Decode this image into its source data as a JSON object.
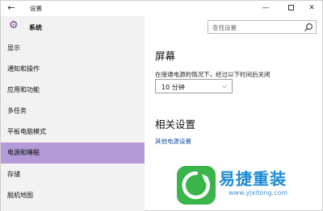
{
  "titlebar": {
    "back_icon": "back-arrow-icon",
    "title": "设置",
    "minimize_glyph": "—",
    "close_glyph": "✕"
  },
  "sidebar": {
    "header_label": "系统",
    "header_icon": "gear-icon",
    "items": [
      {
        "label": "显示",
        "selected": false
      },
      {
        "label": "通知和操作",
        "selected": false
      },
      {
        "label": "应用和功能",
        "selected": false
      },
      {
        "label": "多任务",
        "selected": false
      },
      {
        "label": "平板电脑模式",
        "selected": false
      },
      {
        "label": "电源和睡眠",
        "selected": true
      },
      {
        "label": "存储",
        "selected": false
      },
      {
        "label": "脱机地图",
        "selected": false
      }
    ],
    "selected_color": "#b49ad6"
  },
  "search": {
    "placeholder": "查找设置",
    "icon": "search-icon"
  },
  "main": {
    "screen_heading": "屏幕",
    "screen_desc": "在接通电源的情况下，经过以下时间后关闭",
    "timeout_value": "10 分钟",
    "related_heading": "相关设置",
    "other_power_link": "其他电源设置"
  },
  "watermark": {
    "name": "易捷重装",
    "url": "www.yjxitong.com",
    "brand_color": "#1b8ad6",
    "logo_color": "#39b54a"
  }
}
